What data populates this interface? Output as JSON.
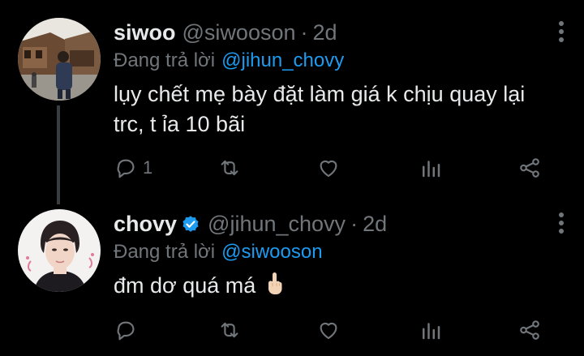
{
  "tweets": [
    {
      "name": "siwoo",
      "handle": "@siwooson",
      "separator": "·",
      "time": "2d",
      "reply_prefix": "Đang trả lời",
      "reply_to": "@jihun_chovy",
      "text": "lụy chết mẹ bày đặt làm giá k chịu quay lại trc, t ỉa 10 bãi",
      "reply_count": "1",
      "verified": false
    },
    {
      "name": "chovy",
      "handle": "@jihun_chovy",
      "separator": "·",
      "time": "2d",
      "reply_prefix": "Đang trả lời",
      "reply_to": "@siwooson",
      "text": "đm dơ quá má",
      "reply_count": "",
      "verified": true
    }
  ],
  "colors": {
    "background": "#000000",
    "primary_text": "#e7e9ea",
    "secondary_text": "#71767b",
    "accent": "#1d9bf0",
    "thread_line": "#3a3d40"
  },
  "icons": [
    "reply-icon",
    "retweet-icon",
    "like-icon",
    "analytics-icon",
    "share-icon",
    "more-icon",
    "verified-badge-icon",
    "middle-finger-emoji"
  ]
}
